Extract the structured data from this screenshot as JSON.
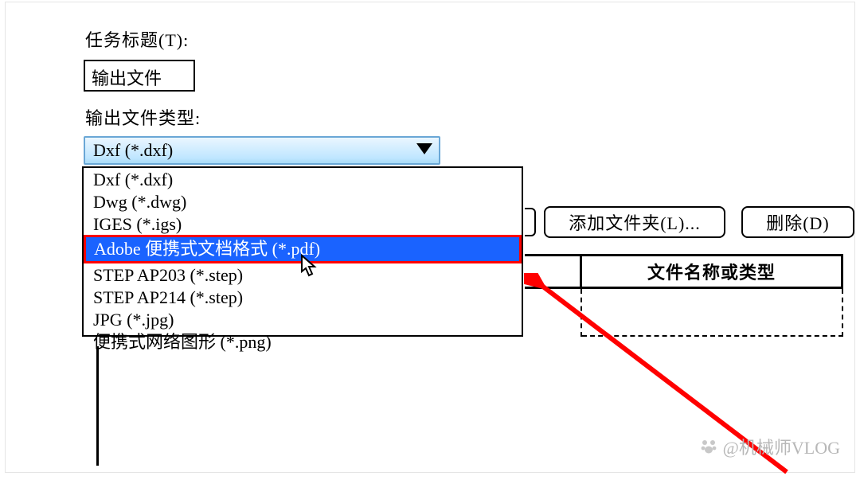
{
  "labels": {
    "task_title": "任务标题(T):",
    "output_file": "输出文件",
    "output_type": "输出文件类型:"
  },
  "combo": {
    "selected": "Dxf (*.dxf)"
  },
  "options": {
    "o0": "Dxf (*.dxf)",
    "o1": "Dwg (*.dwg)",
    "o2": "IGES (*.igs)",
    "o3": "Adobe 便携式文档格式 (*.pdf)",
    "o4": "STEP AP203 (*.step)",
    "o5": "STEP AP214 (*.step)",
    "o6": "JPG (*.jpg)",
    "o7": "便携式网络图形 (*.png)"
  },
  "buttons": {
    "add_folder": "添加文件夹(L)...",
    "delete": "删除(D)"
  },
  "table": {
    "header_right": "文件名称或类型"
  },
  "watermark": {
    "text": "@机械师VLOG"
  }
}
